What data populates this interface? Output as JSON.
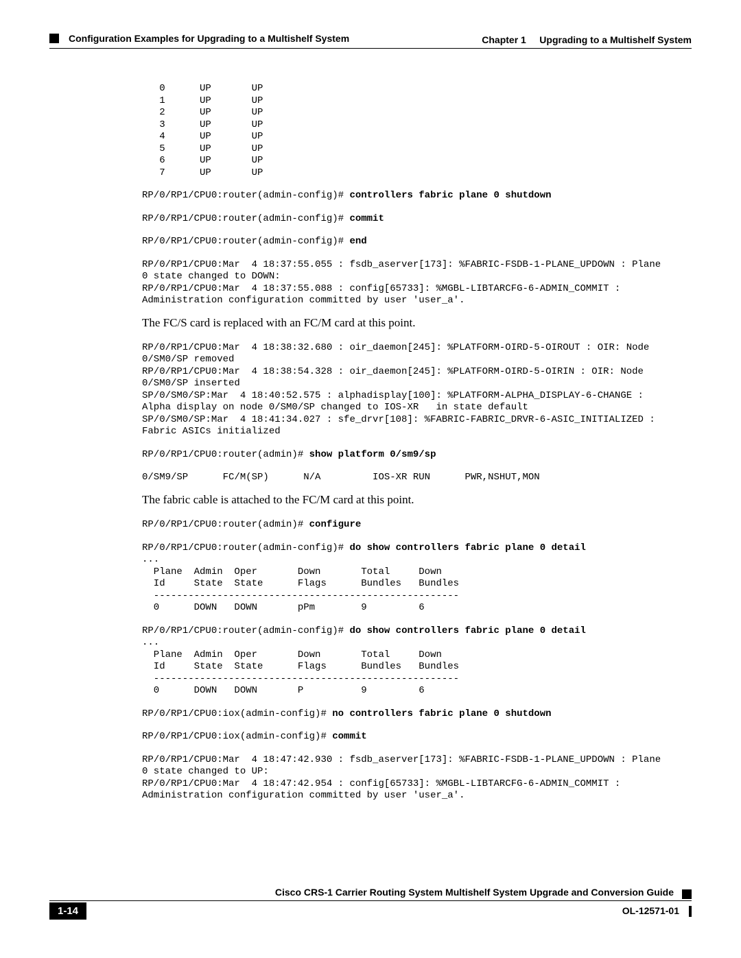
{
  "header": {
    "section": "Configuration Examples for Upgrading to a Multishelf System",
    "chapter_label": "Chapter 1",
    "chapter_title": "Upgrading to a Multishelf System"
  },
  "cli": {
    "up_table": "   0      UP       UP\n   1      UP       UP\n   2      UP       UP\n   3      UP       UP\n   4      UP       UP\n   5      UP       UP\n   6      UP       UP\n   7      UP       UP",
    "p1_prompt": "RP/0/RP1/CPU0:router(admin-config)# ",
    "p1_cmd": "controllers fabric plane 0 shutdown",
    "p2_prompt": "RP/0/RP1/CPU0:router(admin-config)# ",
    "p2_cmd": "commit",
    "p3_prompt": "RP/0/RP1/CPU0:router(admin-config)# ",
    "p3_cmd": "end",
    "log1": "RP/0/RP1/CPU0:Mar  4 18:37:55.055 : fsdb_aserver[173]: %FABRIC-FSDB-1-PLANE_UPDOWN : Plane \n0 state changed to DOWN:\nRP/0/RP1/CPU0:Mar  4 18:37:55.088 : config[65733]: %MGBL-LIBTARCFG-6-ADMIN_COMMIT : \nAdministration configuration committed by user 'user_a'.",
    "log2": "RP/0/RP1/CPU0:Mar  4 18:38:32.680 : oir_daemon[245]: %PLATFORM-OIRD-5-OIROUT : OIR: Node \n0/SM0/SP removed\nRP/0/RP1/CPU0:Mar  4 18:38:54.328 : oir_daemon[245]: %PLATFORM-OIRD-5-OIRIN : OIR: Node \n0/SM0/SP inserted\nSP/0/SM0/SP:Mar  4 18:40:52.575 : alphadisplay[100]: %PLATFORM-ALPHA_DISPLAY-6-CHANGE : \nAlpha display on node 0/SM0/SP changed to IOS-XR   in state default\nSP/0/SM0/SP:Mar  4 18:41:34.027 : sfe_drvr[108]: %FABRIC-FABRIC_DRVR-6-ASIC_INITIALIZED : \nFabric ASICs initialized",
    "p4_prompt": "RP/0/RP1/CPU0:router(admin)# ",
    "p4_cmd": "show platform 0/sm9/sp",
    "platform_row": "0/SM9/SP      FC/M(SP)      N/A         IOS-XR RUN      PWR,NSHUT,MON",
    "p5_prompt": "RP/0/RP1/CPU0:router(admin)# ",
    "p5_cmd": "configure",
    "p6_prompt": "RP/0/RP1/CPU0:router(admin-config)# ",
    "p6_cmd": "do show controllers fabric plane 0 detail",
    "table1": "...\n  Plane  Admin  Oper       Down       Total     Down\n  Id     State  State      Flags      Bundles   Bundles\n  -----------------------------------------------------\n  0      DOWN   DOWN       pPm        9         6",
    "p7_prompt": "RP/0/RP1/CPU0:router(admin-config)# ",
    "p7_cmd": "do show controllers fabric plane 0 detail",
    "table2": "...\n  Plane  Admin  Oper       Down       Total     Down\n  Id     State  State      Flags      Bundles   Bundles\n  -----------------------------------------------------\n  0      DOWN   DOWN       P          9         6",
    "p8_prompt": "RP/0/RP1/CPU0:iox(admin-config)# ",
    "p8_cmd": "no controllers fabric plane 0 shutdown",
    "p9_prompt": "RP/0/RP1/CPU0:iox(admin-config)# ",
    "p9_cmd": "commit",
    "log3": "RP/0/RP1/CPU0:Mar  4 18:47:42.930 : fsdb_aserver[173]: %FABRIC-FSDB-1-PLANE_UPDOWN : Plane \n0 state changed to UP:\nRP/0/RP1/CPU0:Mar  4 18:47:42.954 : config[65733]: %MGBL-LIBTARCFG-6-ADMIN_COMMIT : \nAdministration configuration committed by user 'user_a'."
  },
  "body": {
    "note1": "The FC/S card is replaced with an FC/M card at this point.",
    "note2": "The fabric cable is attached to the FC/M card at this point."
  },
  "footer": {
    "guide": "Cisco CRS-1 Carrier Routing System Multishelf System Upgrade and Conversion Guide",
    "page": "1-14",
    "doc_id": "OL-12571-01"
  }
}
